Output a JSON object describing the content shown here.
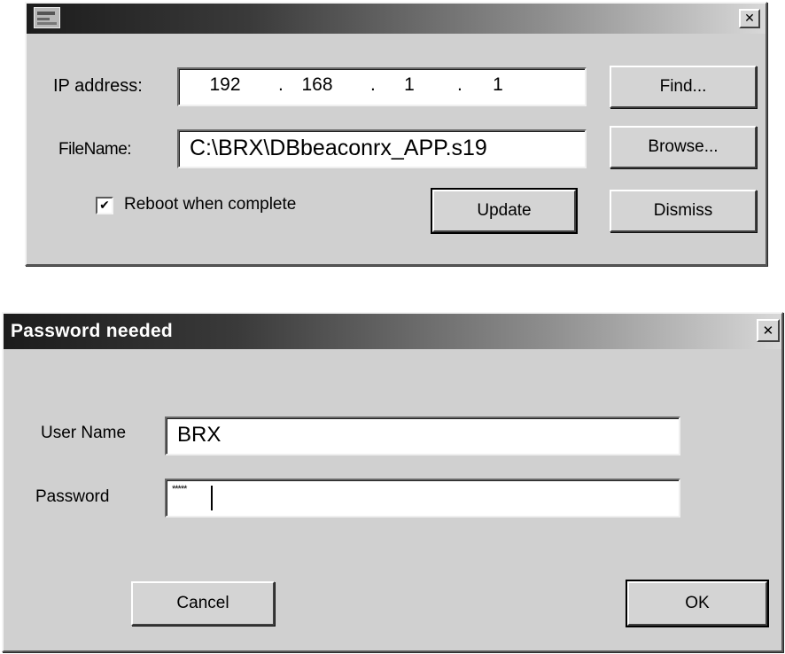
{
  "update_dialog": {
    "title": "",
    "ip_label": "IP address:",
    "ip": [
      "192",
      "168",
      "1",
      "1"
    ],
    "ip_separator": ".",
    "filename_label": "FileName:",
    "filename_value": "C:\\BRX\\DBbeaconrx_APP.s19",
    "reboot_label": "Reboot when complete",
    "reboot_checked": true,
    "check_mark": "✔",
    "buttons": {
      "find": "Find...",
      "browse": "Browse...",
      "update": "Update",
      "dismiss": "Dismiss"
    },
    "close_glyph": "✕"
  },
  "password_dialog": {
    "title": "Password needed",
    "username_label": "User Name",
    "username_value": "BRX",
    "password_label": "Password",
    "password_mask": "*****",
    "buttons": {
      "cancel": "Cancel",
      "ok": "OK"
    },
    "close_glyph": "✕"
  },
  "icons": {
    "app": "app-icon",
    "close": "close-icon",
    "check": "checkbox-check-icon"
  }
}
